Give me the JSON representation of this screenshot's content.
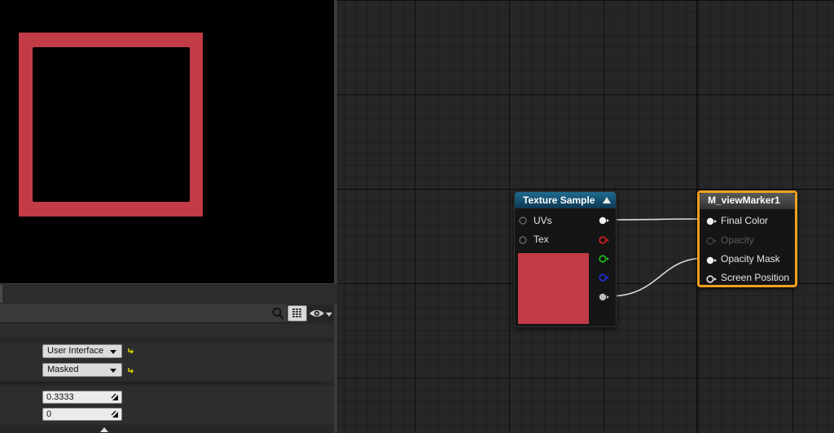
{
  "preview": {
    "swatch_color": "#c23b47"
  },
  "details": {
    "search": {
      "placeholder": "",
      "value": ""
    },
    "rows": [
      {
        "value": "User Interface",
        "type": "combo"
      },
      {
        "value": "Masked",
        "type": "combo"
      },
      {
        "value": "0.3333",
        "type": "number"
      },
      {
        "value": "0",
        "type": "number"
      }
    ]
  },
  "graph": {
    "texture_node": {
      "title": "Texture Sample",
      "inputs": [
        "UVs",
        "Tex"
      ],
      "outputs": [
        "rgb",
        "r",
        "g",
        "b",
        "a"
      ],
      "preview_color": "#c23b47"
    },
    "material_node": {
      "title": "M_viewMarker1",
      "inputs": [
        {
          "label": "Final Color",
          "enabled": true
        },
        {
          "label": "Opacity",
          "enabled": false
        },
        {
          "label": "Opacity Mask",
          "enabled": true
        },
        {
          "label": "Screen Position",
          "enabled": true
        }
      ]
    },
    "connections": [
      {
        "from": "Texture Sample.rgb",
        "to": "M_viewMarker1.Final Color"
      },
      {
        "from": "Texture Sample.a",
        "to": "M_viewMarker1.Opacity Mask"
      }
    ]
  }
}
